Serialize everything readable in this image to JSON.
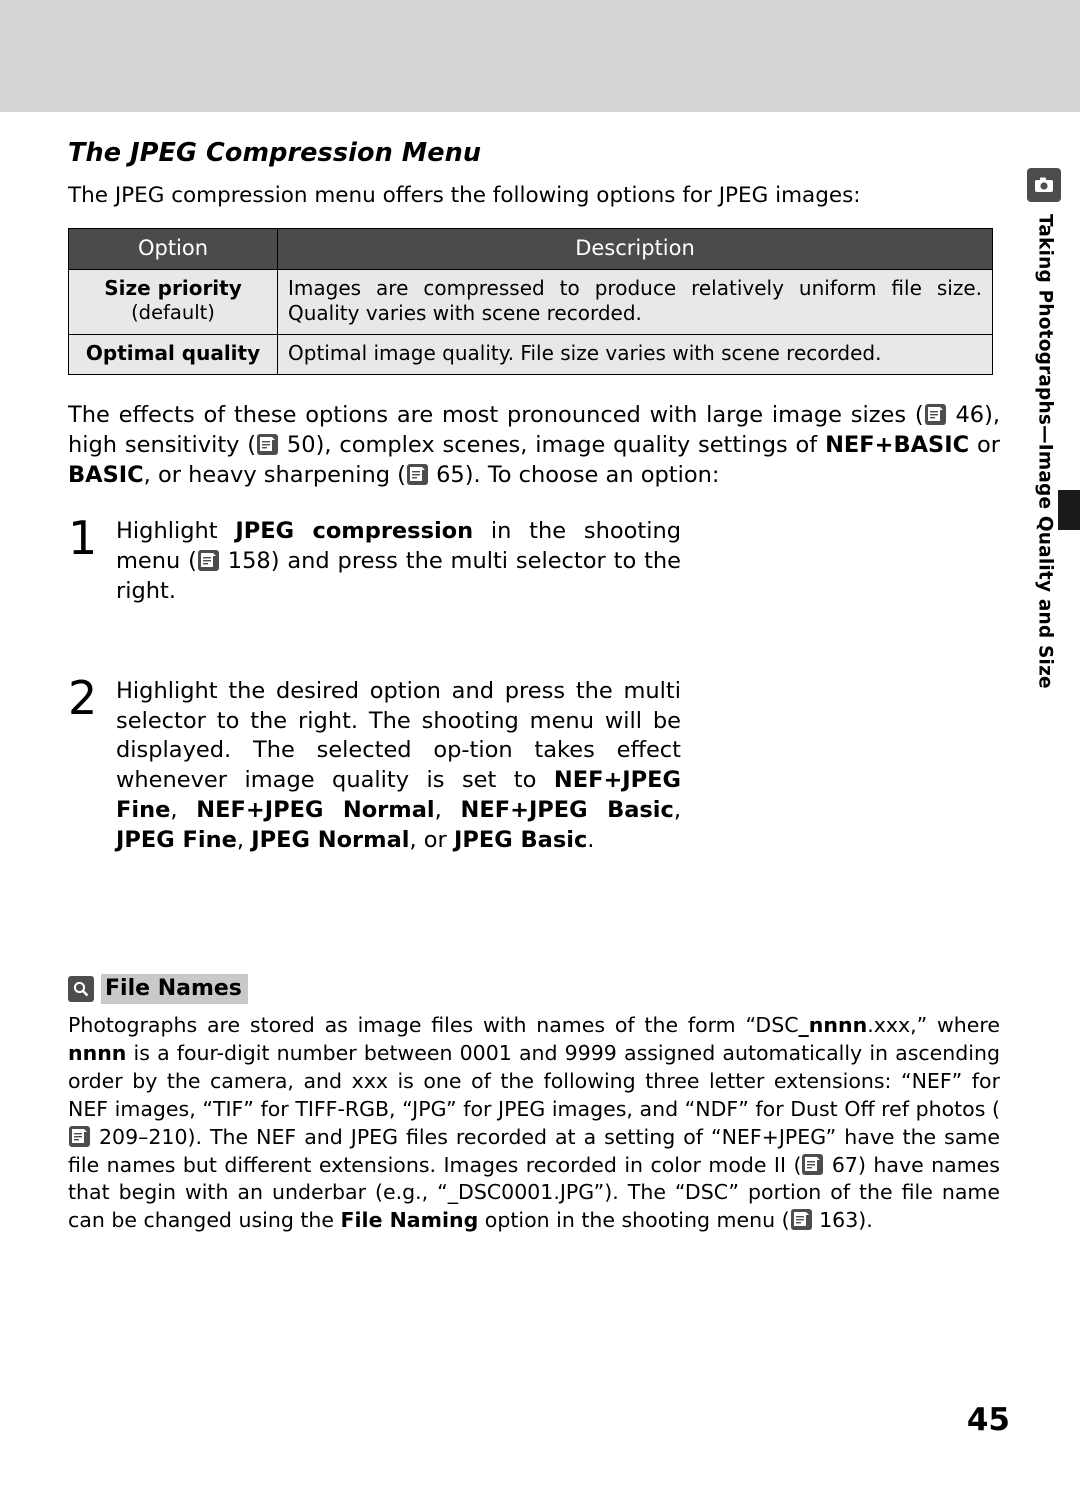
{
  "sidebar": {
    "icon": "camera-icon",
    "vertical_label": "Taking Photographs—Image Quality and Size"
  },
  "section": {
    "title": "The JPEG Compression Menu",
    "intro": "The JPEG compression menu offers the following options for JPEG images:"
  },
  "table": {
    "headers": [
      "Option",
      "Description"
    ],
    "rows": [
      {
        "option": "Size priority",
        "option_note": "(default)",
        "description": "Images are compressed to produce relatively uniform file size. Quality varies with scene recorded."
      },
      {
        "option": "Optimal quality",
        "option_note": "",
        "description": "Optimal image quality.  File size varies with scene recorded."
      }
    ]
  },
  "paragraphs": {
    "effects_1": "The effects of these options are most pronounced with large image sizes (",
    "effects_pg1": "46",
    "effects_2": "), high sensitivity (",
    "effects_pg2": "50",
    "effects_3": "), complex scenes, image quality settings of ",
    "effects_bold1": "NEF+BASIC",
    "effects_4": " or ",
    "effects_bold2": "BASIC",
    "effects_5": ", or heavy sharpening (",
    "effects_pg3": "65",
    "effects_6": ").  To choose an option:"
  },
  "steps": [
    {
      "number": "1",
      "t1": "Highlight ",
      "b1": "JPEG compression",
      "t2": " in the shooting menu (",
      "pg": "158",
      "t3": ") and press the multi selector to the right."
    },
    {
      "number": "2",
      "t1": "Highlight the desired option and press the multi selector to the right.  The shooting menu will be displayed.  The selected op-tion takes effect whenever image quality is set to ",
      "b1": "NEF+JPEG Fine",
      "t2": ", ",
      "b2": "NEF+JPEG Normal",
      "t3": ", ",
      "b3": "NEF+JPEG Basic",
      "t4": ", ",
      "b4": "JPEG Fine",
      "t5": ", ",
      "b5": "JPEG Normal",
      "t6": ", or ",
      "b6": "JPEG Basic",
      "t7": "."
    }
  ],
  "note": {
    "icon": "magnifier-icon",
    "title": "File Names",
    "text_1": "Photographs are stored as image files with names of the form “DSC",
    "text_nnnn": "_nnnn",
    "text_2": ".xxx,” where ",
    "text_nnnn2": "nnnn",
    "text_3": " is a four-digit number between 0001 and 9999 assigned automatically in ascending order by the camera, and xxx is one of the following three letter extensions: “NEF” for NEF images, “TIF” for TIFF-RGB, “JPG” for JPEG images, and “NDF” for Dust Off ref photos (",
    "pg_1": "209–210",
    "text_4": ").  The NEF and JPEG files recorded at a setting of “NEF+JPEG” have the same file names but different extensions.  Images recorded in color mode II (",
    "pg_2": "67",
    "text_5": ") have names that begin with an underbar (e.g., “_DSC0001.JPG”).  The “DSC” portion of the file name can be changed using the ",
    "bold_1": "File Naming",
    "text_6": " option in the shooting menu (",
    "pg_3": "163",
    "text_7": ")."
  },
  "page_number": "45"
}
